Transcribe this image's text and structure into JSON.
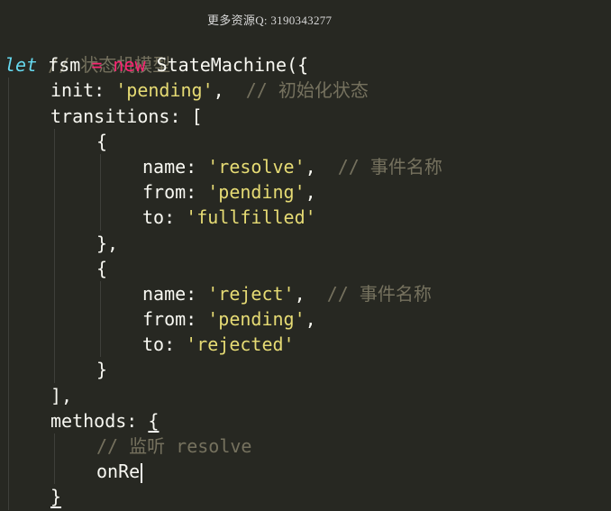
{
  "watermark": "更多资源Q: 3190343277",
  "editor": {
    "lines": {
      "l1_comment": "// 状态机模型",
      "l2_let": "let",
      "l2_var": " fsm ",
      "l2_eq": "=",
      "l2_new": " new",
      "l2_rest": " StateMachine({",
      "l3_key": "init: ",
      "l3_val": "'pending'",
      "l3_comma": ",",
      "l3_comment": "  // 初始化状态",
      "l4_text": "transitions: [",
      "l5_text": "{",
      "l6_key": "name: ",
      "l6_val": "'resolve'",
      "l6_comma": ",",
      "l6_comment": "  // 事件名称",
      "l7_key": "from: ",
      "l7_val": "'pending'",
      "l7_comma": ",",
      "l8_key": "to: ",
      "l8_val": "'fullfilled'",
      "l9_text": "},",
      "l10_text": "{",
      "l11_key": "name: ",
      "l11_val": "'reject'",
      "l11_comma": ",",
      "l11_comment": "  // 事件名称",
      "l12_key": "from: ",
      "l12_val": "'pending'",
      "l12_comma": ",",
      "l13_key": "to: ",
      "l13_val": "'rejected'",
      "l14_text": "}",
      "l15_text": "],",
      "l16_key": "methods: ",
      "l16_brace": "{",
      "l17_comment": "// 监听 resolve",
      "l18_text": "onRe",
      "l19_text": "}"
    }
  }
}
